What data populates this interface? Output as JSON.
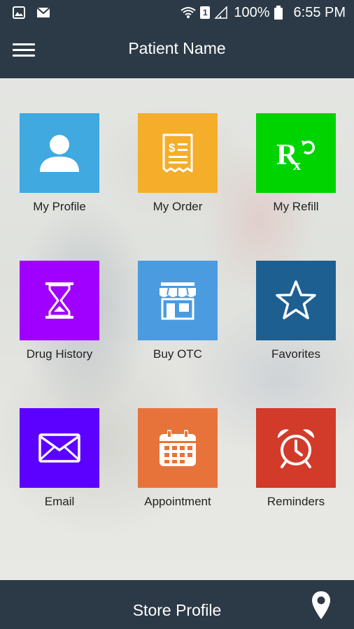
{
  "status_bar": {
    "left_icons": [
      "image-icon",
      "mail-icon"
    ],
    "right_icons": [
      "wifi-icon",
      "sim-icon",
      "signal-icon",
      "battery-icon"
    ],
    "sim_number": "1",
    "battery_percent": "100%",
    "time": "6:55 PM"
  },
  "app_bar": {
    "title": "Patient Name",
    "menu_icon": "hamburger-menu-icon"
  },
  "tiles": [
    {
      "label": "My Profile",
      "color": "#3fa9e0",
      "icon": "person-icon"
    },
    {
      "label": "My Order",
      "color": "#f4ae2a",
      "icon": "receipt-icon"
    },
    {
      "label": "My Refill",
      "color": "#00d400",
      "icon": "rx-refill-icon"
    },
    {
      "label": "Drug History",
      "color": "#a000ff",
      "icon": "hourglass-icon"
    },
    {
      "label": "Buy OTC",
      "color": "#4b9be0",
      "icon": "storefront-icon"
    },
    {
      "label": "Favorites",
      "color": "#1d5f91",
      "icon": "star-icon"
    },
    {
      "label": "Email",
      "color": "#5c00ff",
      "icon": "envelope-icon"
    },
    {
      "label": "Appointment",
      "color": "#e8733a",
      "icon": "calendar-icon"
    },
    {
      "label": "Reminders",
      "color": "#d23a2a",
      "icon": "alarm-clock-icon"
    }
  ],
  "bottom_bar": {
    "title": "Store Profile",
    "icon": "location-pin-icon"
  }
}
